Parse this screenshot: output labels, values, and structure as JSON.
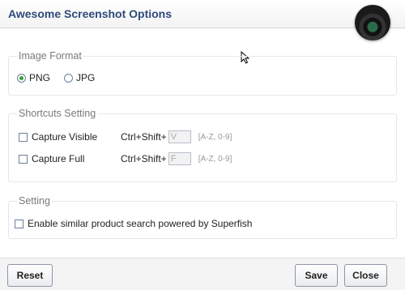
{
  "window": {
    "title": "Awesome Screenshot Options"
  },
  "image_format": {
    "legend": "Image Format",
    "options": [
      {
        "label": "PNG",
        "checked": true
      },
      {
        "label": "JPG",
        "checked": false
      }
    ]
  },
  "shortcuts": {
    "legend": "Shortcuts Setting",
    "items": [
      {
        "label": "Capture Visible",
        "modifier": "Ctrl+Shift+",
        "key": "V",
        "hint": "[A-Z, 0-9]"
      },
      {
        "label": "Capture Full",
        "modifier": "Ctrl+Shift+",
        "key": "F",
        "hint": "[A-Z, 0-9]"
      }
    ]
  },
  "setting": {
    "legend": "Setting",
    "superfish_label": "Enable similar product search powered by Superfish"
  },
  "footer": {
    "reset_label": "Reset",
    "save_label": "Save",
    "close_label": "Close"
  },
  "colors": {
    "title": "#2d4a7a",
    "radio_selected": "#3aa03a",
    "legend": "#7a7a7a"
  }
}
